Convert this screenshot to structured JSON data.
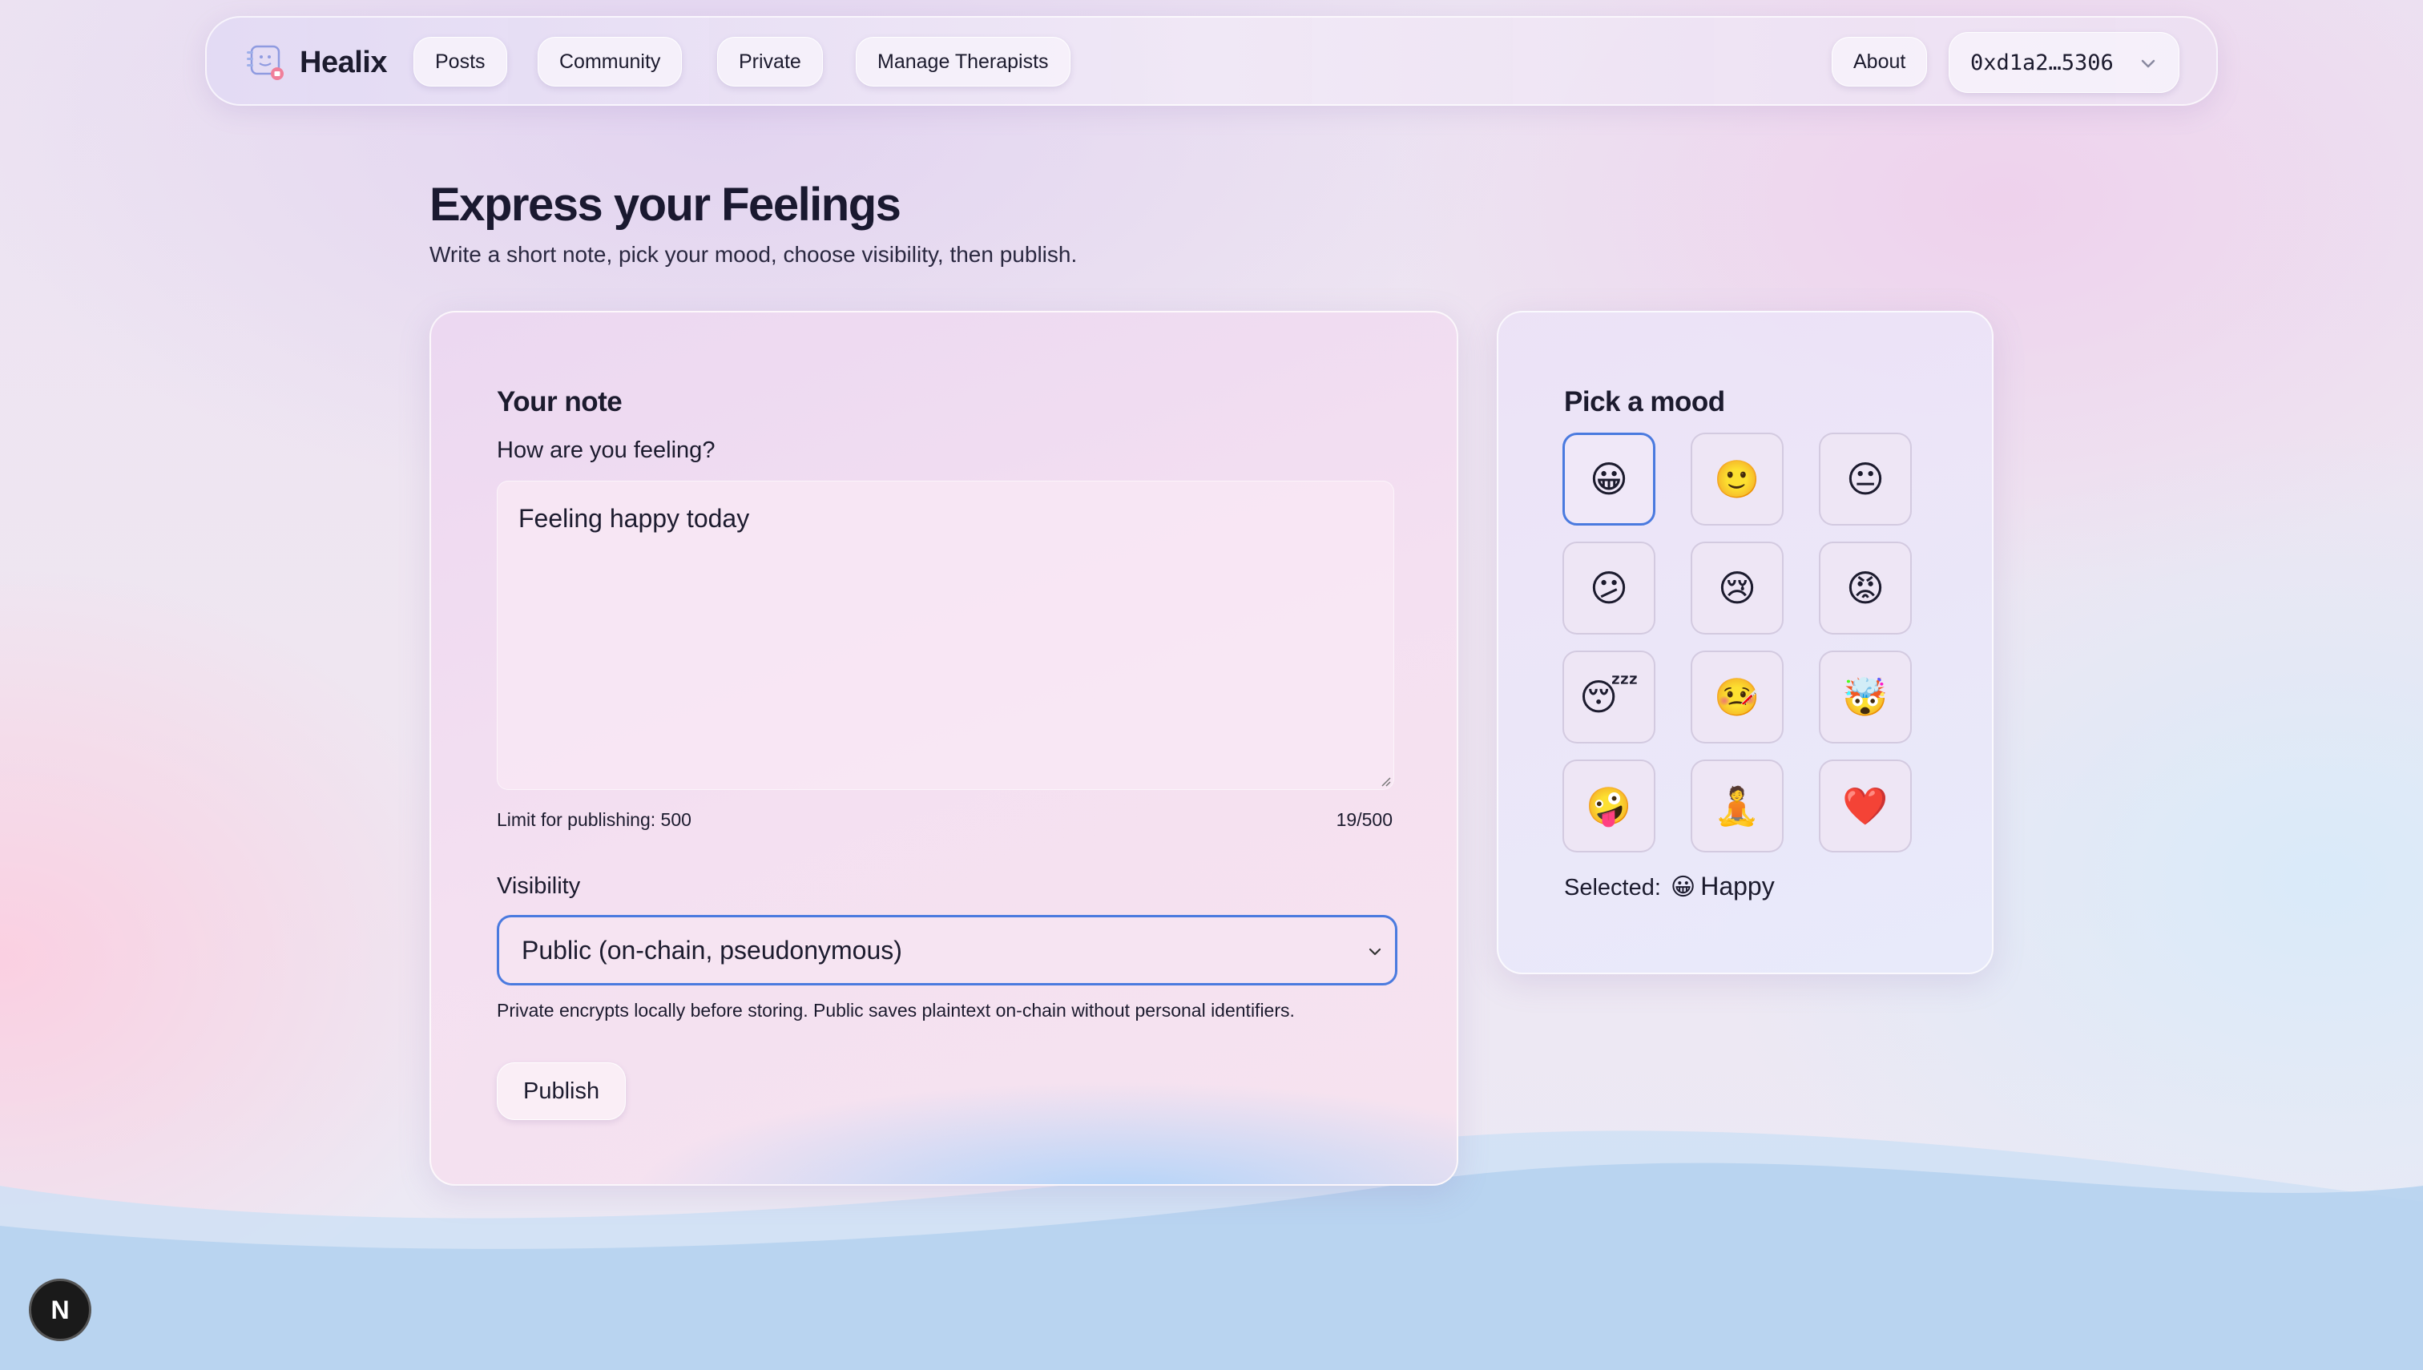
{
  "brand": {
    "name": "Healix"
  },
  "nav": {
    "posts": "Posts",
    "community": "Community",
    "private": "Private",
    "manage_therapists": "Manage Therapists",
    "about": "About",
    "wallet": "0xd1a2…5306"
  },
  "header": {
    "title": "Express your Feelings",
    "subtitle": "Write a short note, pick your mood, choose visibility, then publish."
  },
  "note": {
    "title": "Your note",
    "prompt": "How are you feeling?",
    "text": "Feeling happy today",
    "limit_label": "Limit for publishing: 500",
    "counter": "19/500",
    "visibility_label": "Visibility",
    "visibility_value": "Public (on-chain, pseudonymous)",
    "visibility_help": "Private encrypts locally before storing. Public saves plaintext on-chain without personal identifiers.",
    "publish": "Publish"
  },
  "mood": {
    "title": "Pick a mood",
    "options": [
      "😀",
      "🙂",
      "😐",
      "😕",
      "😢",
      "😡",
      "😴",
      "🤒",
      "🤯",
      "🤪",
      "🧘",
      "❤️"
    ],
    "selected_index": 0,
    "selected_label": "Selected:",
    "selected_emoji": "😀",
    "selected_value": "Happy"
  },
  "dev_badge": "N",
  "colors": {
    "accent": "#4a7adf",
    "text": "#1c1b2e",
    "wave": "#b3d4f1"
  }
}
